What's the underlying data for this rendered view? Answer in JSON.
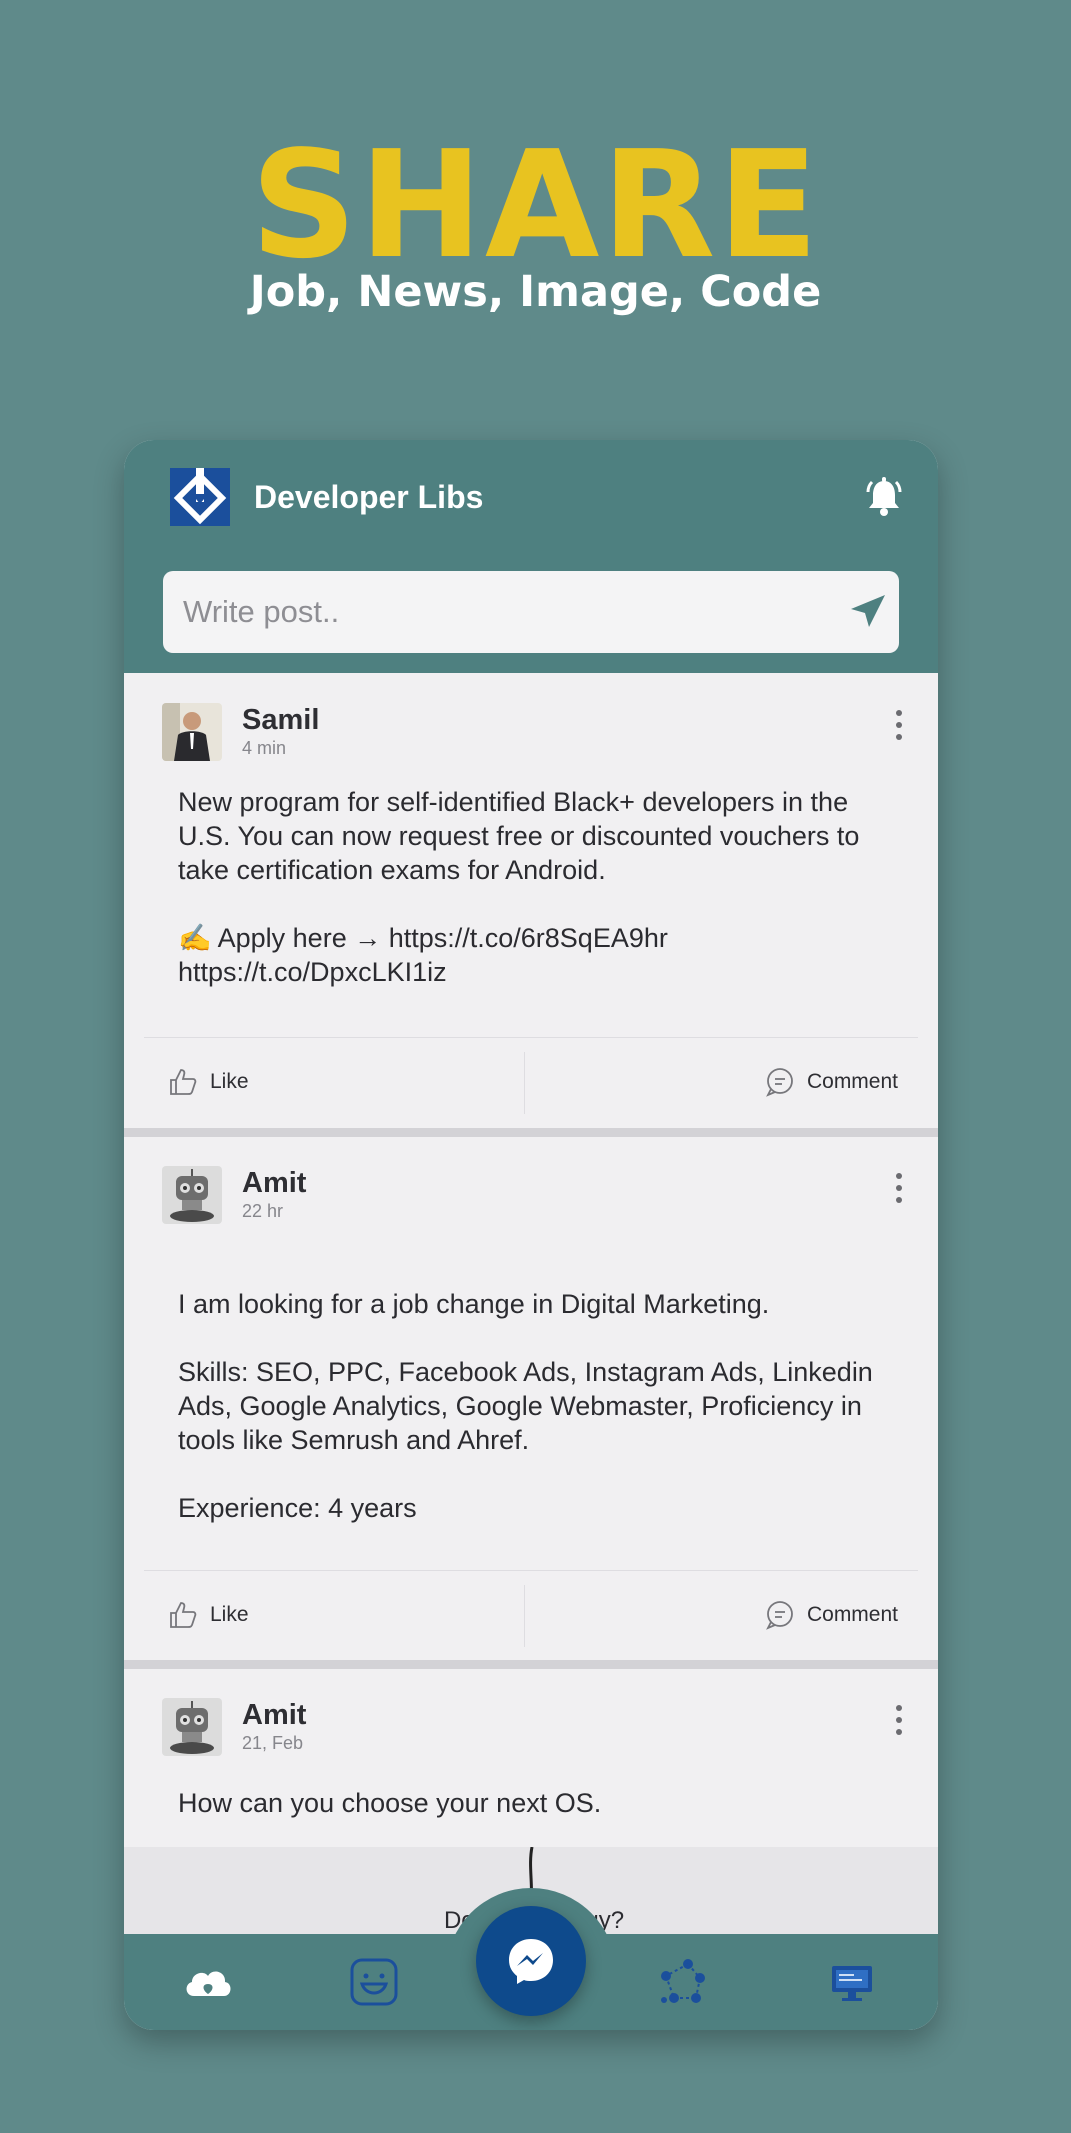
{
  "promo": {
    "headline": "SHARE",
    "subline": "Job, News, Image, Code"
  },
  "app": {
    "title": "Developer Libs",
    "compose_placeholder": "Write post.."
  },
  "actions": {
    "like_label": "Like",
    "comment_label": "Comment"
  },
  "posts": [
    {
      "author": "Samil",
      "time": "4 min",
      "body": "New program for self-identified Black+ developers in the U.S. You can now request free or discounted vouchers to take certification exams for Android.\n\n✍️ Apply here → https://t.co/6r8SqEA9hr\nhttps://t.co/DpxcLKI1iz"
    },
    {
      "author": "Amit",
      "time": "22 hr",
      "body": "I am looking for a job change in Digital Marketing.\n\nSkills: SEO, PPC, Facebook Ads, Instagram Ads, Linkedin Ads, Google Analytics, Google Webmaster, Proficiency in tools like Semrush and Ahref.\n\nExperience: 4 years"
    },
    {
      "author": "Amit",
      "time": "21, Feb",
      "body": "How can you choose your next OS.",
      "image_caption": "Do you ... ology?"
    }
  ],
  "bottom_nav": {
    "items": [
      "cloud-icon",
      "smile-icon",
      "messenger-icon",
      "network-icon",
      "monitor-icon"
    ]
  },
  "colors": {
    "background": "#5f8a8a",
    "headline": "#e8c320",
    "appbar": "#4e8080",
    "logo": "#1b4f9c",
    "fab": "#0e4a8c",
    "card": "#f1f0f2"
  }
}
